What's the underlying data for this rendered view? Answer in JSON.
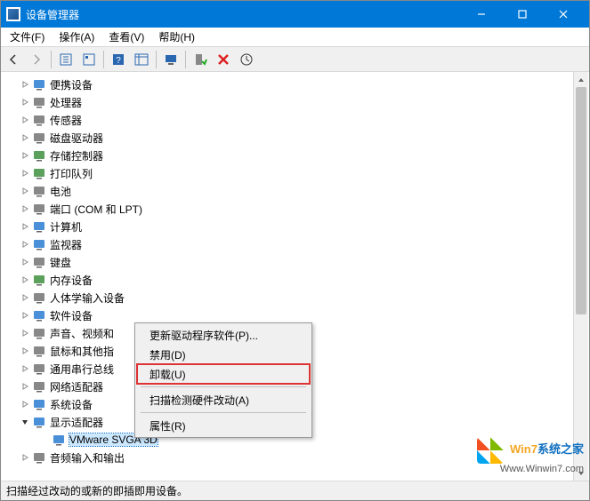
{
  "window": {
    "title": "设备管理器"
  },
  "menu": {
    "file": "文件(F)",
    "action": "操作(A)",
    "view": "查看(V)",
    "help": "帮助(H)"
  },
  "toolbar_icons": {
    "back": "back-icon",
    "forward": "forward-icon",
    "show_hide": "show-hide-tree-icon",
    "properties": "properties-icon",
    "help": "help-icon",
    "details": "details-icon",
    "monitor": "monitor-icon",
    "enable": "enable-device-icon",
    "disable": "disable-device-icon",
    "scan": "scan-devices-icon"
  },
  "tree": [
    {
      "label": "便携设备",
      "expandable": true
    },
    {
      "label": "处理器",
      "expandable": true
    },
    {
      "label": "传感器",
      "expandable": true
    },
    {
      "label": "磁盘驱动器",
      "expandable": true
    },
    {
      "label": "存储控制器",
      "expandable": true
    },
    {
      "label": "打印队列",
      "expandable": true
    },
    {
      "label": "电池",
      "expandable": true
    },
    {
      "label": "端口 (COM 和 LPT)",
      "expandable": true
    },
    {
      "label": "计算机",
      "expandable": true
    },
    {
      "label": "监视器",
      "expandable": true
    },
    {
      "label": "键盘",
      "expandable": true
    },
    {
      "label": "内存设备",
      "expandable": true
    },
    {
      "label": "人体学输入设备",
      "expandable": true
    },
    {
      "label": "软件设备",
      "expandable": true
    },
    {
      "label": "声音、视频和",
      "expandable": true,
      "truncated": true
    },
    {
      "label": "鼠标和其他指",
      "expandable": true,
      "truncated": true
    },
    {
      "label": "通用串行总线",
      "expandable": true,
      "truncated": true
    },
    {
      "label": "网络适配器",
      "expandable": true
    },
    {
      "label": "系统设备",
      "expandable": true
    },
    {
      "label": "显示适配器",
      "expandable": true,
      "expanded": true,
      "children": [
        {
          "label": "VMware SVGA 3D",
          "selected": true
        }
      ]
    },
    {
      "label": "音频输入和输出",
      "expandable": true
    }
  ],
  "context_menu": {
    "update": "更新驱动程序软件(P)...",
    "disable": "禁用(D)",
    "uninstall": "卸载(U)",
    "scan": "扫描检测硬件改动(A)",
    "properties": "属性(R)"
  },
  "context_menu_highlight": "uninstall",
  "status": "扫描经过改动的或新的即插即用设备。",
  "watermark": {
    "line1_a": "Win7",
    "line1_b": "系统之家",
    "line2": "Www.Winwin7.com"
  }
}
